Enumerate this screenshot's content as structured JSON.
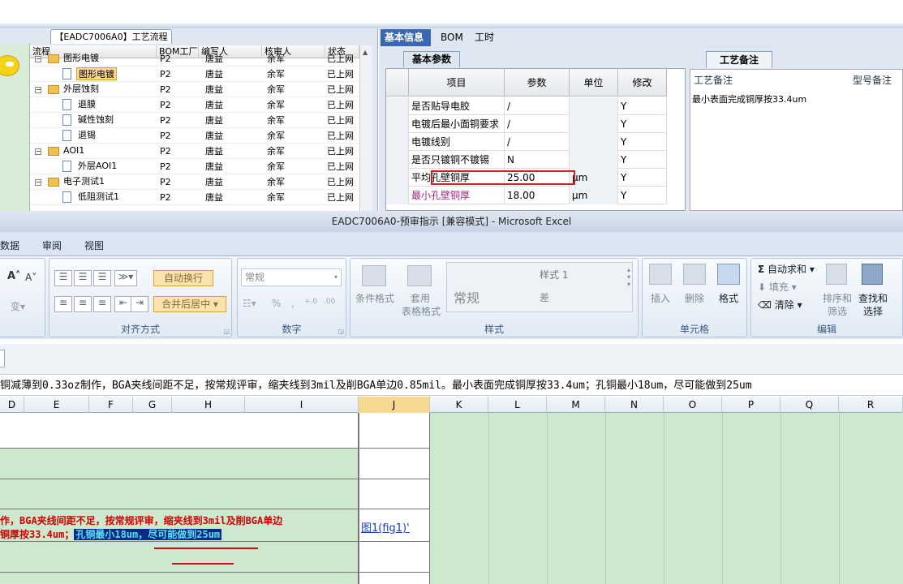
{
  "left_panel": {
    "title": "【EADC7006A0】工艺流程",
    "columns": [
      "流程",
      "BOM工厂",
      "编写人",
      "核审人",
      "状态"
    ],
    "rows": [
      {
        "name": "图形电镀",
        "factory": "P2",
        "writer": "唐益",
        "reviewer": "余军",
        "status": "已上网",
        "kind": "folder",
        "indent": 1
      },
      {
        "name": "图形电镀",
        "factory": "P2",
        "writer": "唐益",
        "reviewer": "余军",
        "status": "已上网",
        "kind": "doc",
        "indent": 2,
        "selected": true
      },
      {
        "name": "外层蚀刻",
        "factory": "P2",
        "writer": "唐益",
        "reviewer": "余军",
        "status": "已上网",
        "kind": "folder",
        "indent": 1
      },
      {
        "name": "退膜",
        "factory": "P2",
        "writer": "唐益",
        "reviewer": "余军",
        "status": "已上网",
        "kind": "doc",
        "indent": 2
      },
      {
        "name": "碱性蚀刻",
        "factory": "P2",
        "writer": "唐益",
        "reviewer": "余军",
        "status": "已上网",
        "kind": "doc",
        "indent": 2
      },
      {
        "name": "退锡",
        "factory": "P2",
        "writer": "唐益",
        "reviewer": "余军",
        "status": "已上网",
        "kind": "doc",
        "indent": 2
      },
      {
        "name": "AOI1",
        "factory": "P2",
        "writer": "唐益",
        "reviewer": "余军",
        "status": "已上网",
        "kind": "folder",
        "indent": 1
      },
      {
        "name": "外层AOI1",
        "factory": "P2",
        "writer": "唐益",
        "reviewer": "余军",
        "status": "已上网",
        "kind": "doc",
        "indent": 2
      },
      {
        "name": "电子测试1",
        "factory": "P2",
        "writer": "唐益",
        "reviewer": "余军",
        "status": "已上网",
        "kind": "folder",
        "indent": 1
      },
      {
        "name": "低阻测试1",
        "factory": "P2",
        "writer": "唐益",
        "reviewer": "余军",
        "status": "已上网",
        "kind": "doc",
        "indent": 2
      }
    ]
  },
  "right_panel": {
    "tabs": [
      "基本信息",
      "BOM",
      "工时"
    ],
    "subtab": "基本参数",
    "grid_headers": [
      "项目",
      "参数",
      "单位",
      "修改"
    ],
    "grid_rows": [
      {
        "item": "是否贴导电胶",
        "param": "/",
        "unit": "",
        "mod": "Y"
      },
      {
        "item": "电镀后最小面铜要求",
        "param": "/",
        "unit": "",
        "mod": "Y"
      },
      {
        "item": "电镀线别",
        "param": "/",
        "unit": "",
        "mod": "Y"
      },
      {
        "item": "是否只镀铜不镀锡",
        "param": "N",
        "unit": "",
        "mod": "Y"
      },
      {
        "item": "平均孔壁铜厚",
        "param": "25.00",
        "unit": "μm",
        "mod": "Y"
      },
      {
        "item": "最小孔壁铜厚",
        "param": "18.00",
        "unit": "μm",
        "mod": "Y"
      }
    ],
    "notes_tab": "工艺备注",
    "notes_headers": [
      "工艺备注",
      "型号备注"
    ],
    "notes_text": "最小表面完成铜厚按33.4um"
  },
  "excel": {
    "title": "EADC7006A0-预审指示 [兼容模式] - Microsoft Excel",
    "menus": [
      "数据",
      "审阅",
      "视图"
    ],
    "ribbon": {
      "wrap_text": "自动换行",
      "merge_center": "合并后居中",
      "number_format": "常规",
      "style1": "样式 1",
      "style_normal": "常规",
      "style_bad": "差",
      "cond_format": "条件格式",
      "table_format_1": "套用",
      "table_format_2": "表格格式",
      "insert": "插入",
      "delete": "删除",
      "format": "格式",
      "autosum": "自动求和",
      "fill": "填充",
      "clear": "清除",
      "sort_1": "排序和",
      "sort_2": "筛选",
      "find_1": "查找和",
      "find_2": "选择",
      "percent": "%",
      "groups": [
        "对齐方式",
        "数字",
        "样式",
        "单元格",
        "编辑"
      ]
    },
    "formula_text": "铜减薄到0.33oz制作，BGA夹线间距不足，按常规评审，缩夹线到3mil及削BGA单边0.85mil。最小表面完成铜厚按33.4um；孔铜最小18um，尽可能做到25um",
    "columns": [
      "D",
      "E",
      "F",
      "G",
      "H",
      "I",
      "J",
      "K",
      "L",
      "M",
      "N",
      "O",
      "P",
      "Q",
      "R"
    ],
    "cell_line1": "作，BGA夹线间距不足，按常规评审，缩夹线到3mil及削BGA单边",
    "cell_line2_plain": "铜厚按33.4um；",
    "cell_line2_highlight": "孔铜最小18um，尽可能做到25um",
    "link_text": "图1(fig1)'"
  }
}
